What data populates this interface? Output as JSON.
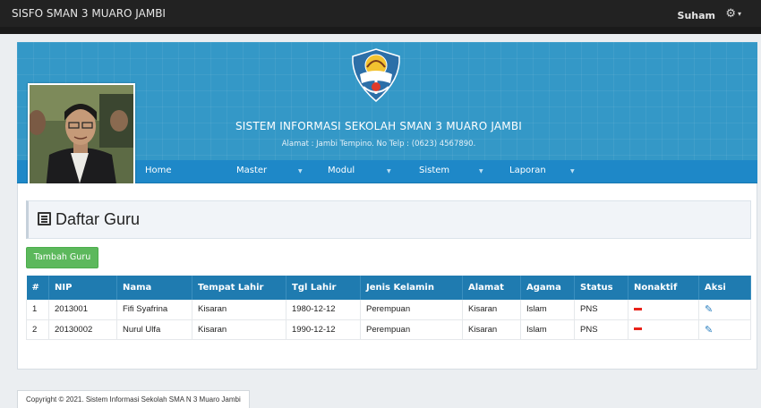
{
  "topbar": {
    "brand": "SISFO SMAN 3 MUARO JAMBI",
    "user": "Suham",
    "settings_icon": "gear-icon"
  },
  "banner": {
    "title": "SISTEM INFORMASI SEKOLAH SMAN 3 MUARO JAMBI",
    "address": "Alamat : Jambi Tempino. No Telp : (0623) 4567890."
  },
  "nav": {
    "home": "Home",
    "master": "Master",
    "modul": "Modul",
    "sistem": "Sistem",
    "laporan": "Laporan"
  },
  "page": {
    "title": "Daftar Guru",
    "add_button": "Tambah Guru"
  },
  "table": {
    "headers": [
      "#",
      "NIP",
      "Nama",
      "Tempat Lahir",
      "Tgl Lahir",
      "Jenis Kelamin",
      "Alamat",
      "Agama",
      "Status",
      "Nonaktif",
      "Aksi"
    ],
    "rows": [
      [
        "1",
        "2013001",
        "Fifi Syafrina",
        "Kisaran",
        "1980-12-12",
        "Perempuan",
        "Kisaran",
        "Islam",
        "PNS"
      ],
      [
        "2",
        "20130002",
        "Nurul Ulfa",
        "Kisaran",
        "1990-12-12",
        "Perempuan",
        "Kisaran",
        "Islam",
        "PNS"
      ]
    ]
  },
  "footer": {
    "text": "Copyright © 2021. Sistem Informasi Sekolah SMA N 3 Muaro Jambi"
  },
  "colors": {
    "topbar": "#222222",
    "banner": "#3498c7",
    "nav": "#1e88c8",
    "table_header": "#1f7bb0",
    "add_button": "#5cb85c"
  }
}
